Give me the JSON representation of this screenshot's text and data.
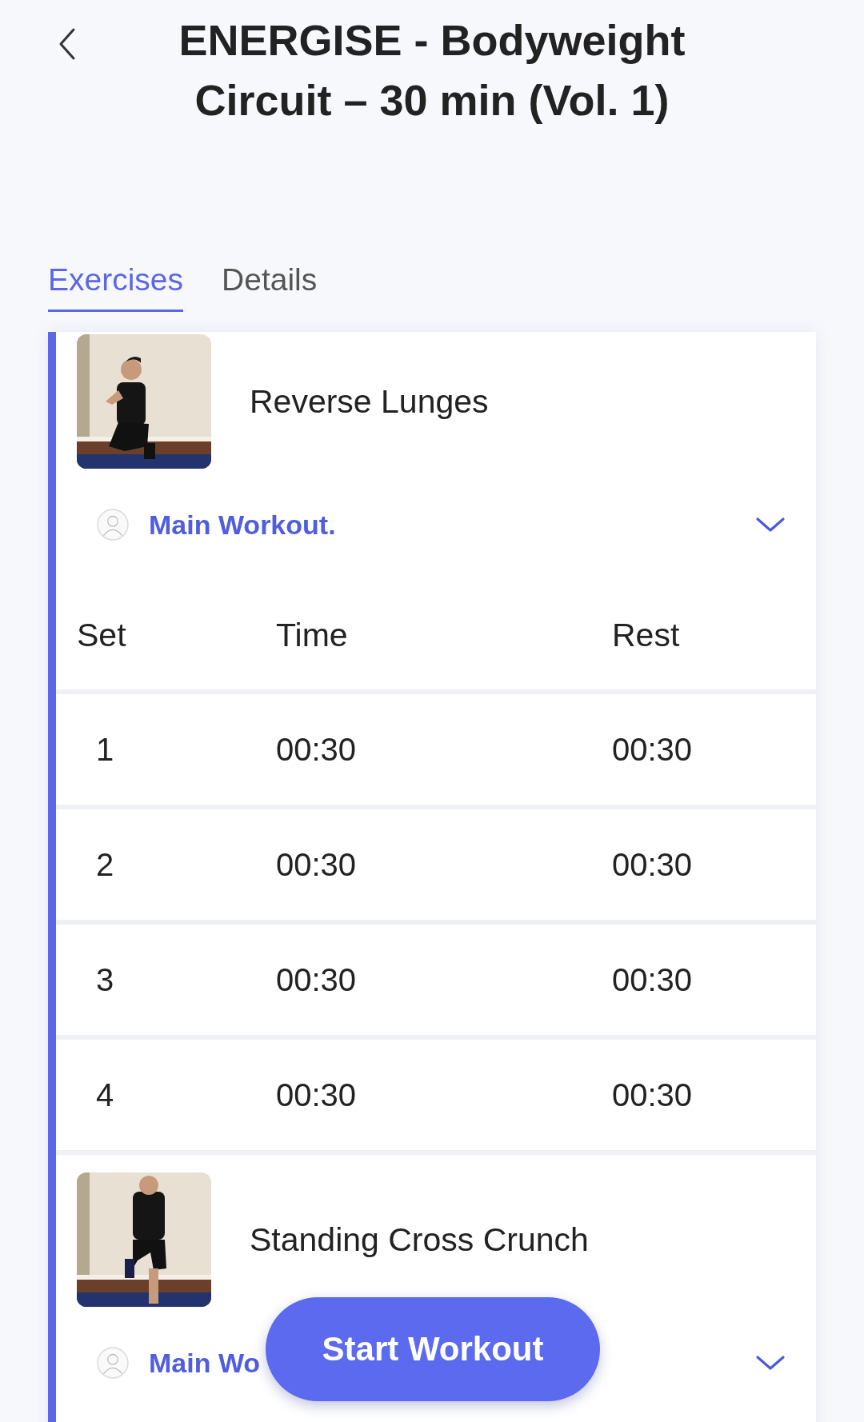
{
  "title": "ENERGISE - Bodyweight Circuit – 30 min (Vol. 1)",
  "tabs": [
    {
      "label": "Exercises",
      "selected": true
    },
    {
      "label": "Details",
      "selected": false
    }
  ],
  "exercises": [
    {
      "name": "Reverse Lunges",
      "section": "Main Workout.",
      "columns": [
        "Set",
        "Time",
        "Rest"
      ],
      "sets": [
        {
          "set": "1",
          "time": "00:30",
          "rest": "00:30"
        },
        {
          "set": "2",
          "time": "00:30",
          "rest": "00:30"
        },
        {
          "set": "3",
          "time": "00:30",
          "rest": "00:30"
        },
        {
          "set": "4",
          "time": "00:30",
          "rest": "00:30"
        }
      ]
    },
    {
      "name": "Standing Cross Crunch",
      "section": "Main Wo"
    }
  ],
  "start_button": "Start Workout"
}
